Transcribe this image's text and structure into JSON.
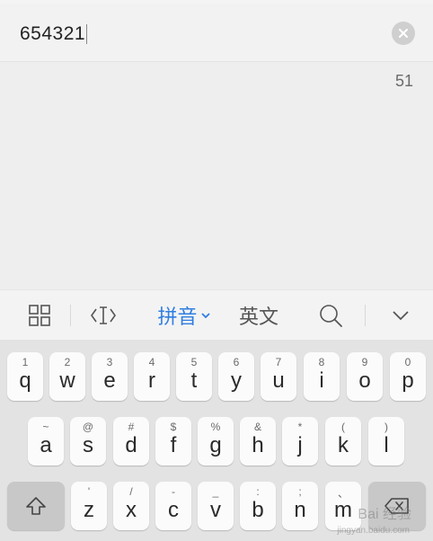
{
  "input": {
    "value": "654321"
  },
  "counter": "51",
  "toolbar": {
    "grid_icon": "grid-icon",
    "cursor_icon": "text-cursor-icon",
    "pinyin_label": "拼音",
    "english_label": "英文",
    "search_icon": "search-icon",
    "collapse_icon": "chevron-down-icon",
    "accent_color": "#2f7de1"
  },
  "keyboard": {
    "row1": [
      {
        "hint": "1",
        "key": "q"
      },
      {
        "hint": "2",
        "key": "w"
      },
      {
        "hint": "3",
        "key": "e"
      },
      {
        "hint": "4",
        "key": "r"
      },
      {
        "hint": "5",
        "key": "t"
      },
      {
        "hint": "6",
        "key": "y"
      },
      {
        "hint": "7",
        "key": "u"
      },
      {
        "hint": "8",
        "key": "i"
      },
      {
        "hint": "9",
        "key": "o"
      },
      {
        "hint": "0",
        "key": "p"
      }
    ],
    "row2": [
      {
        "hint": "~",
        "key": "a"
      },
      {
        "hint": "@",
        "key": "s"
      },
      {
        "hint": "#",
        "key": "d"
      },
      {
        "hint": "$",
        "key": "f"
      },
      {
        "hint": "%",
        "key": "g"
      },
      {
        "hint": "&",
        "key": "h"
      },
      {
        "hint": "*",
        "key": "j"
      },
      {
        "hint": "(",
        "key": "k"
      },
      {
        "hint": ")",
        "key": "l"
      }
    ],
    "row3": [
      {
        "hint": "'",
        "key": "z"
      },
      {
        "hint": "/",
        "key": "x"
      },
      {
        "hint": "-",
        "key": "c"
      },
      {
        "hint": "_",
        "key": "v"
      },
      {
        "hint": ":",
        "key": "b"
      },
      {
        "hint": ";",
        "key": "n"
      },
      {
        "hint": "、",
        "key": "m"
      }
    ]
  },
  "watermark": {
    "brand": "Bai 经验",
    "sub": "jingyan.baidu.com"
  }
}
